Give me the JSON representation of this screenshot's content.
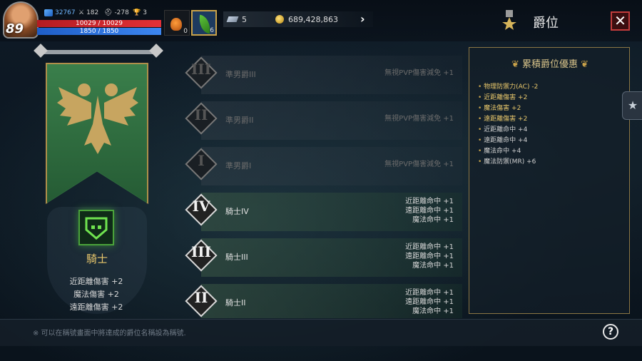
{
  "hud": {
    "level": "89",
    "stat_power": "32767",
    "stat_attack": "182",
    "stat_defense": "-278",
    "stat_trophy": "3",
    "hp": "10029 / 10029",
    "mp": "1850 / 1850",
    "potion_count": "0",
    "leaf_count": "6",
    "gems": "5",
    "gold": "689,428,863"
  },
  "header": {
    "title": "爵位",
    "close_label": "✕"
  },
  "current_rank": {
    "name": "騎士",
    "bonuses": [
      "近距離傷害 +2",
      "魔法傷害 +2",
      "遠距離傷害 +2"
    ]
  },
  "rank_list": [
    {
      "numeral": "III",
      "name": "準男爵III",
      "effects": [
        "無視PVP傷害減免 +1"
      ],
      "state": "locked"
    },
    {
      "numeral": "II",
      "name": "準男爵II",
      "effects": [
        "無視PVP傷害減免 +1"
      ],
      "state": "locked"
    },
    {
      "numeral": "I",
      "name": "準男爵I",
      "effects": [
        "無視PVP傷害減免 +1"
      ],
      "state": "locked"
    },
    {
      "numeral": "IV",
      "name": "騎士IV",
      "effects": [
        "近距離命中 +1",
        "遠距離命中 +1",
        "魔法命中 +1"
      ],
      "state": "active"
    },
    {
      "numeral": "III",
      "name": "騎士III",
      "effects": [
        "近距離命中 +1",
        "遠距離命中 +1",
        "魔法命中 +1"
      ],
      "state": "active"
    },
    {
      "numeral": "II",
      "name": "騎士II",
      "effects": [
        "近距離命中 +1",
        "遠距離命中 +1",
        "魔法命中 +1"
      ],
      "state": "active"
    }
  ],
  "cumulative": {
    "title": "累積爵位優惠",
    "items": [
      "物理防禦力(AC) -2",
      "近距離傷害 +2",
      "魔法傷害 +2",
      "遠距離傷害 +2",
      "近距離命中 +4",
      "遠距離命中 +4",
      "魔法命中 +4",
      "魔法防禦(MR) +6"
    ],
    "item_colors": [
      "#e8c76b",
      "#e8c76b",
      "#e8c76b",
      "#e8c76b",
      "#cfcfcf",
      "#cfcfcf",
      "#cfcfcf",
      "#cfcfcf"
    ]
  },
  "footer": {
    "note": "※ 可以在稱號畫面中將達成的爵位名稱設為稱號.",
    "help_label": "?"
  },
  "colors": {
    "gold_accent": "#c9a24a",
    "hp_red": "#e23137",
    "mp_blue": "#3c86f0",
    "banner_green": "#2e6a3d"
  }
}
